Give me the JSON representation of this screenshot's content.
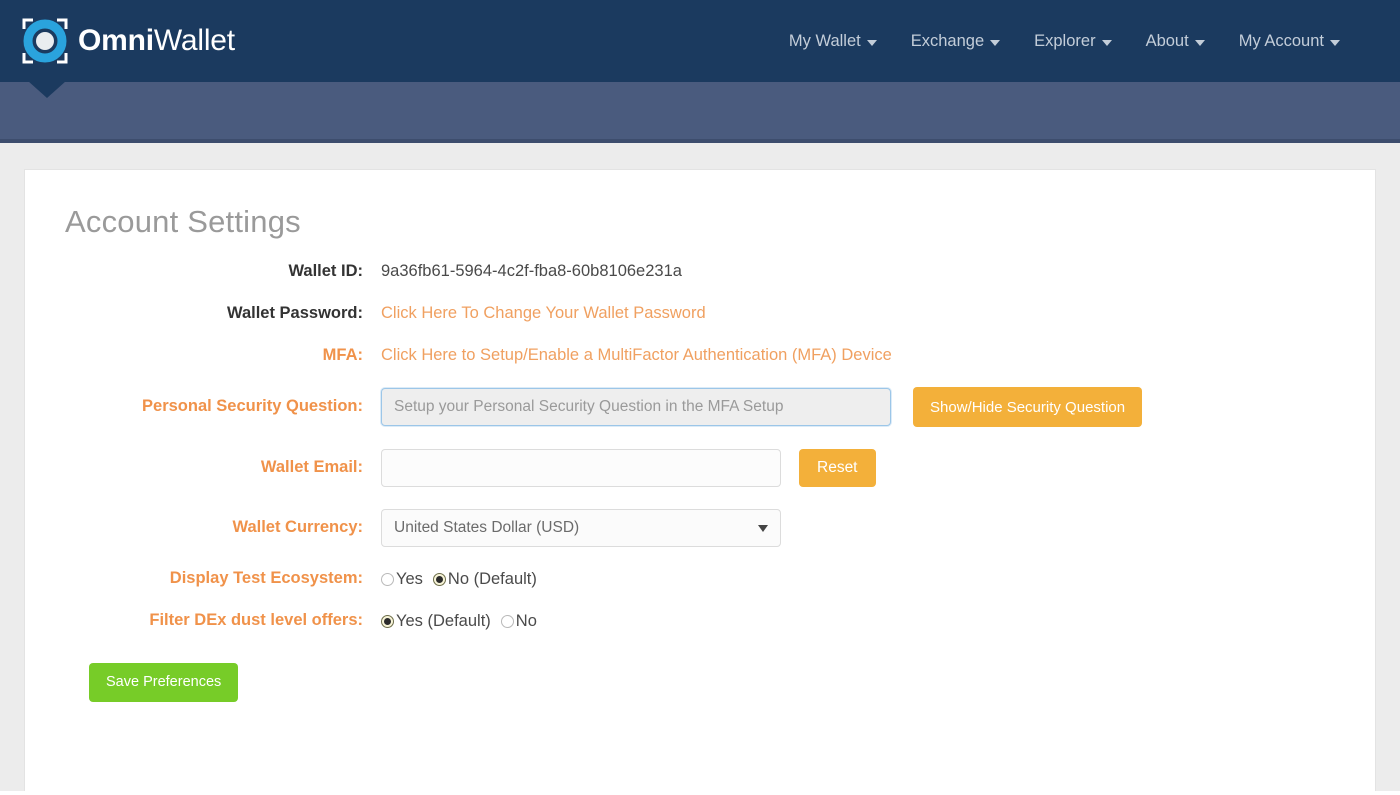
{
  "header": {
    "brand_bold": "Omni",
    "brand_light": "Wallet",
    "logo_icon": "omni-ring-logo-icon",
    "nav": [
      {
        "label": "My Wallet",
        "icon": "chevron-down-icon"
      },
      {
        "label": "Exchange",
        "icon": "chevron-down-icon"
      },
      {
        "label": "Explorer",
        "icon": "chevron-down-icon"
      },
      {
        "label": "About",
        "icon": "chevron-down-icon"
      },
      {
        "label": "My Account",
        "icon": "chevron-down-icon"
      }
    ]
  },
  "main": {
    "title": "Account Settings",
    "rows": {
      "wallet_id": {
        "label": "Wallet ID:",
        "value": "9a36fb61-5964-4c2f-fba8-60b8106e231a"
      },
      "wallet_password": {
        "label": "Wallet Password:",
        "link": "Click Here To Change Your Wallet Password"
      },
      "mfa": {
        "label": "MFA:",
        "link": "Click Here to Setup/Enable a MultiFactor Authentication (MFA) Device"
      },
      "security_question": {
        "label": "Personal Security Question:",
        "value": "",
        "placeholder": "Setup your Personal Security Question in the MFA Setup",
        "button": "Show/Hide Security Question"
      },
      "wallet_email": {
        "label": "Wallet Email:",
        "value": "",
        "placeholder": "",
        "button": "Reset"
      },
      "wallet_currency": {
        "label": "Wallet Currency:",
        "selected": "United States Dollar (USD)",
        "arrow_icon": "select-arrow-icon"
      },
      "display_test_ecosystem": {
        "label": "Display Test Ecosystem:",
        "options": [
          {
            "label": "Yes",
            "selected": false
          },
          {
            "label": "No (Default)",
            "selected": true
          }
        ]
      },
      "filter_dex_dust": {
        "label": "Filter DEx dust level offers:",
        "options": [
          {
            "label": "Yes (Default)",
            "selected": true
          },
          {
            "label": "No",
            "selected": false
          }
        ]
      }
    },
    "save_button": "Save Preferences"
  },
  "colors": {
    "header_navy": "#1b3a5f",
    "subbar_slate": "#4a5b7e",
    "label_orange": "#f0924a",
    "link_orange": "#f0a060",
    "amber_button": "#f3b03a",
    "green_button": "#77cc28",
    "page_background": "#ececec"
  }
}
